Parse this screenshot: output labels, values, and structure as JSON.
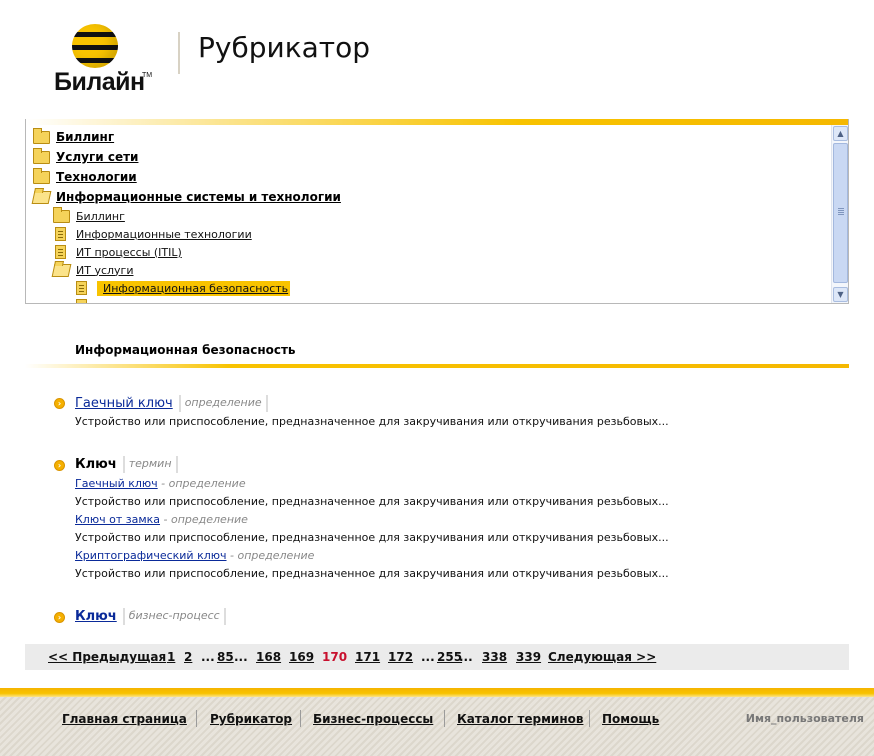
{
  "header": {
    "logo_text": "Билайн",
    "logo_tm": "TM",
    "title": "Рубрикатор"
  },
  "tree": {
    "items": [
      {
        "label": "Биллинг",
        "icon": "folder-icon",
        "level": 0
      },
      {
        "label": "Услуги сети",
        "icon": "folder-icon",
        "level": 0
      },
      {
        "label": "Технологии",
        "icon": "folder-icon",
        "level": 0
      },
      {
        "label": "Информационные системы и технологии",
        "icon": "folder-open-icon",
        "level": 0
      },
      {
        "label": "Биллинг",
        "icon": "folder-icon",
        "level": 1
      },
      {
        "label": "Информационные технологии",
        "icon": "document-icon",
        "level": 1
      },
      {
        "label": "ИТ процессы (ITIL)",
        "icon": "document-icon",
        "level": 1
      },
      {
        "label": "ИТ услуги",
        "icon": "folder-open-icon",
        "level": 1
      },
      {
        "label": "Информационная безопасность",
        "icon": "document-icon",
        "level": 2,
        "selected": true
      }
    ]
  },
  "section": {
    "title": "Информационная безопасность"
  },
  "results": [
    {
      "title": "Гаечный ключ",
      "tag": "определение",
      "description": "Устройство или приспособление, предназначенное для закручивания или откручивания резьбовых..."
    },
    {
      "title": "Ключ",
      "tag": "термин",
      "children": [
        {
          "link": "Гаечный ключ",
          "kind": " - определение",
          "description": "Устройство или приспособление, предназначенное для закручивания или откручивания резьбовых..."
        },
        {
          "link": "Ключ от замка",
          "kind": " - определение",
          "description": "Устройство или приспособление, предназначенное для закручивания или откручивания резьбовых..."
        },
        {
          "link": "Криптографический ключ",
          "kind": " - определение",
          "description": "Устройство или приспособление, предназначенное для закручивания или откручивания резьбовых..."
        }
      ]
    },
    {
      "title": "Ключ",
      "tag": "бизнес-процесс"
    }
  ],
  "pagination": {
    "prev": "<< Предыдущая",
    "next": "Следующая >>",
    "p1": "1",
    "p2": "2",
    "ellipsis": "...",
    "p85": "85",
    "p168": "168",
    "p169": "169",
    "current": "170",
    "p171": "171",
    "p172": "172",
    "p255": "255",
    "p338": "338",
    "p339": "339"
  },
  "footer": {
    "links": [
      "Главная страница",
      "Рубрикатор",
      "Бизнес-процессы",
      "Каталог терминов",
      "Помощь"
    ],
    "username": "Имя_пользователя"
  },
  "colors": {
    "accent": "#f8c300",
    "link": "#0a2a99",
    "current_page": "#c8102e"
  }
}
